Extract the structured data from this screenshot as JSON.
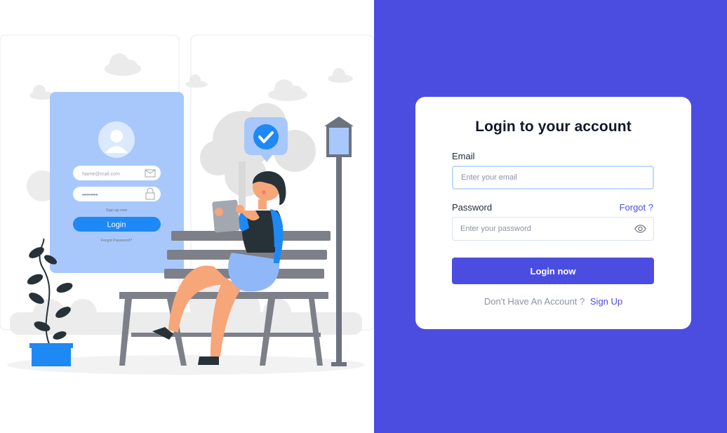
{
  "illustration": {
    "mini_email_placeholder": "Name@mail.com",
    "mini_password_mask": "••••••••",
    "mini_signup_text": "Sign up now",
    "mini_login_label": "Login",
    "mini_forgot_text": "Forgot Password?"
  },
  "login": {
    "title": "Login to your account",
    "email_label": "Email",
    "email_placeholder": "Enter your email",
    "password_label": "Password",
    "forgot_label": "Forgot ?",
    "password_placeholder": "Enter your password",
    "submit_label": "Login now",
    "no_account_text": "Don't Have An Account ?",
    "signup_label": "Sign Up"
  },
  "colors": {
    "accent": "#4b4de1",
    "illustration_blue": "#a8c8fb",
    "button_blue": "#1e88f5"
  },
  "icons": [
    "eye-icon",
    "mail-icon",
    "lock-icon",
    "user-icon",
    "checkmark-icon"
  ]
}
